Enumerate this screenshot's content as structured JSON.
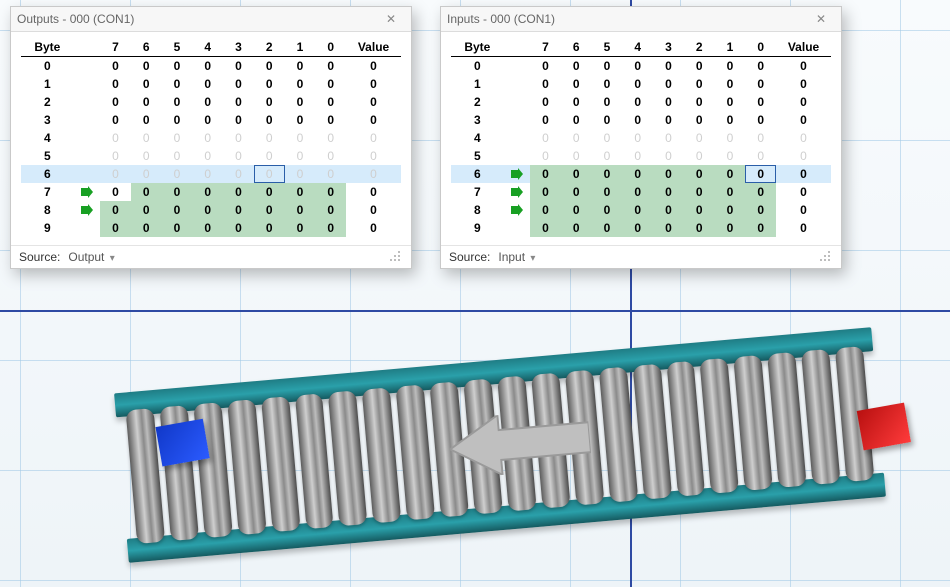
{
  "panels": [
    {
      "key": "outputs",
      "title": "Outputs - 000 (CON1)",
      "source_label": "Source:",
      "source_value": "Output",
      "selected_row": 6,
      "selected_bit": 2,
      "arrows": [
        7,
        8
      ],
      "highlight": {
        "7": [
          0,
          1,
          2,
          3,
          4,
          5,
          6
        ],
        "8": [
          0,
          1,
          2,
          3,
          4,
          5,
          6,
          7
        ],
        "9": [
          0,
          1,
          2,
          3,
          4,
          5,
          6,
          7
        ]
      },
      "rows": [
        {
          "byte": 0,
          "ghost": false,
          "bits": [
            0,
            0,
            0,
            0,
            0,
            0,
            0,
            0
          ],
          "value": 0
        },
        {
          "byte": 1,
          "ghost": false,
          "bits": [
            0,
            0,
            0,
            0,
            0,
            0,
            0,
            0
          ],
          "value": 0
        },
        {
          "byte": 2,
          "ghost": false,
          "bits": [
            0,
            0,
            0,
            0,
            0,
            0,
            0,
            0
          ],
          "value": 0
        },
        {
          "byte": 3,
          "ghost": false,
          "bits": [
            0,
            0,
            0,
            0,
            0,
            0,
            0,
            0
          ],
          "value": 0
        },
        {
          "byte": 4,
          "ghost": true,
          "bits": [
            0,
            0,
            0,
            0,
            0,
            0,
            0,
            0
          ],
          "value": 0
        },
        {
          "byte": 5,
          "ghost": true,
          "bits": [
            0,
            0,
            0,
            0,
            0,
            0,
            0,
            0
          ],
          "value": 0
        },
        {
          "byte": 6,
          "ghost": true,
          "bits": [
            0,
            0,
            0,
            0,
            0,
            0,
            0,
            0
          ],
          "value": 0
        },
        {
          "byte": 7,
          "ghost": false,
          "bits": [
            0,
            0,
            0,
            0,
            0,
            0,
            0,
            0
          ],
          "value": 0
        },
        {
          "byte": 8,
          "ghost": false,
          "bits": [
            0,
            0,
            0,
            0,
            0,
            0,
            0,
            0
          ],
          "value": 0
        },
        {
          "byte": 9,
          "ghost": false,
          "bits": [
            0,
            0,
            0,
            0,
            0,
            0,
            0,
            0
          ],
          "value": 0
        }
      ]
    },
    {
      "key": "inputs",
      "title": "Inputs - 000 (CON1)",
      "source_label": "Source:",
      "source_value": "Input",
      "selected_row": 6,
      "selected_bit": 0,
      "arrows": [
        6,
        7,
        8
      ],
      "highlight": {
        "6": [
          1,
          2,
          3,
          4,
          5,
          6,
          7
        ],
        "7": [
          0,
          1,
          2,
          3,
          4,
          5,
          6,
          7
        ],
        "8": [
          0,
          1,
          2,
          3,
          4,
          5,
          6,
          7
        ],
        "9": [
          0,
          1,
          2,
          3,
          4,
          5,
          6,
          7
        ]
      },
      "rows": [
        {
          "byte": 0,
          "ghost": false,
          "bits": [
            0,
            0,
            0,
            0,
            0,
            0,
            0,
            0
          ],
          "value": 0
        },
        {
          "byte": 1,
          "ghost": false,
          "bits": [
            0,
            0,
            0,
            0,
            0,
            0,
            0,
            0
          ],
          "value": 0
        },
        {
          "byte": 2,
          "ghost": false,
          "bits": [
            0,
            0,
            0,
            0,
            0,
            0,
            0,
            0
          ],
          "value": 0
        },
        {
          "byte": 3,
          "ghost": false,
          "bits": [
            0,
            0,
            0,
            0,
            0,
            0,
            0,
            0
          ],
          "value": 0
        },
        {
          "byte": 4,
          "ghost": true,
          "bits": [
            0,
            0,
            0,
            0,
            0,
            0,
            0,
            0
          ],
          "value": 0
        },
        {
          "byte": 5,
          "ghost": true,
          "bits": [
            0,
            0,
            0,
            0,
            0,
            0,
            0,
            0
          ],
          "value": 0
        },
        {
          "byte": 6,
          "ghost": false,
          "bits": [
            0,
            0,
            0,
            0,
            0,
            0,
            0,
            0
          ],
          "value": 0
        },
        {
          "byte": 7,
          "ghost": false,
          "bits": [
            0,
            0,
            0,
            0,
            0,
            0,
            0,
            0
          ],
          "value": 0
        },
        {
          "byte": 8,
          "ghost": false,
          "bits": [
            0,
            0,
            0,
            0,
            0,
            0,
            0,
            0
          ],
          "value": 0
        },
        {
          "byte": 9,
          "ghost": false,
          "bits": [
            0,
            0,
            0,
            0,
            0,
            0,
            0,
            0
          ],
          "value": 0
        }
      ]
    }
  ],
  "headers": {
    "byte": "Byte",
    "bits": [
      "7",
      "6",
      "5",
      "4",
      "3",
      "2",
      "1",
      "0"
    ],
    "value": "Value"
  }
}
